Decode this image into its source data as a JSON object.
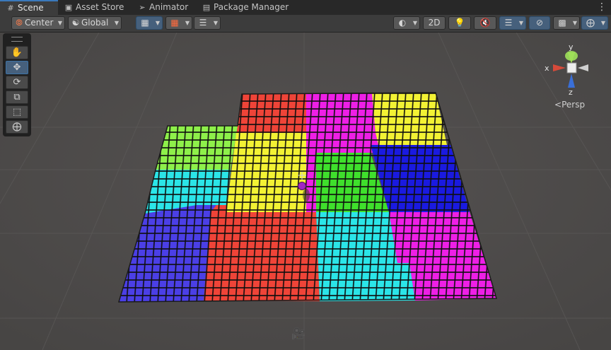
{
  "tabs": [
    {
      "label": "Scene",
      "icon": "grid-icon",
      "active": true
    },
    {
      "label": "Asset Store",
      "icon": "bag-icon",
      "active": false
    },
    {
      "label": "Animator",
      "icon": "animator-icon",
      "active": false
    },
    {
      "label": "Package Manager",
      "icon": "package-icon",
      "active": false
    }
  ],
  "toolbar": {
    "pivot_label": "Center",
    "space_label": "Global",
    "mode_2d_label": "2D"
  },
  "gizmo": {
    "x_label": "x",
    "y_label": "y",
    "z_label": "z",
    "projection_label": "Persp"
  },
  "colors": {
    "red": "#ef4438",
    "magenta": "#ee1fe6",
    "yellow": "#f3f234",
    "green": "#8ef04a",
    "lime": "#3fe02c",
    "blue": "#1a1ae0",
    "cyan": "#2be5e8",
    "indigo": "#4b3fe6",
    "tab_accent": "#3a79bb"
  }
}
